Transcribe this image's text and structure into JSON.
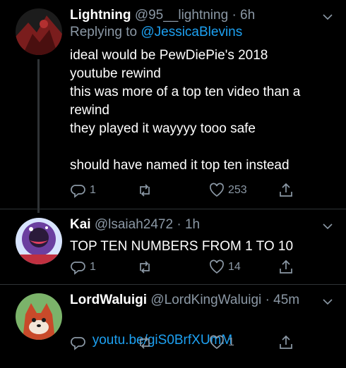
{
  "tweets": [
    {
      "name": "Lightning",
      "handle": "@95__lightning",
      "time": "· 6h",
      "replying_label": "Replying to",
      "replying_to": "@JessicaBlevins",
      "text": "ideal would be PewDiePie's 2018\nyoutube rewind\nthis was more of a top ten video than a\nrewind\nthey played it wayyyy tooo safe\n\nshould have named it top ten instead",
      "replies": "1",
      "retweets": "",
      "likes": "253",
      "avatar_colors": [
        "#7a1d1d",
        "#1c1c1c"
      ]
    },
    {
      "name": "Kai",
      "handle": "@lsaiah2472",
      "time": "· 1h",
      "text": "TOP TEN NUMBERS FROM 1 TO 10",
      "replies": "1",
      "retweets": "",
      "likes": "14",
      "avatar_colors": [
        "#6b3fa0",
        "#d8e4ff"
      ]
    },
    {
      "name": "LordWaluigi",
      "handle": "@LordKingWaluigi",
      "time": "· 45m",
      "link": "youtu.be/giS0BrfXUmM",
      "replies": "",
      "retweets": "",
      "likes": "1",
      "avatar_colors": [
        "#c84a2a",
        "#7bb36a"
      ]
    }
  ],
  "icons": {
    "reply": "reply-icon",
    "retweet": "retweet-icon",
    "like": "heart-icon",
    "share": "share-icon",
    "caret": "chevron-down-icon"
  },
  "colors": {
    "background": "#000000",
    "secondary_text": "#8b98a5",
    "link": "#1da1f2",
    "divider": "#2f3336"
  }
}
